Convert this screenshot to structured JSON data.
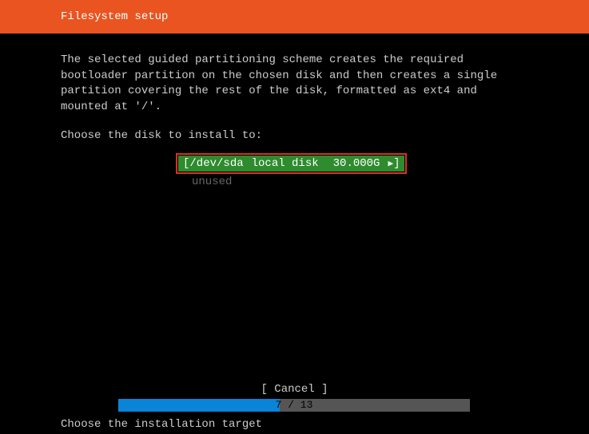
{
  "header": {
    "title": "Filesystem setup"
  },
  "main": {
    "description": "The selected guided partitioning scheme creates the required bootloader partition on the chosen disk and then creates a single partition covering the rest of the disk, formatted as ext4 and mounted at '/'.",
    "prompt": "Choose the disk to install to:",
    "disk": {
      "bracket_open": "[ ",
      "device": "/dev/sda",
      "type": "local disk",
      "size": "30.000G",
      "bracket_close": " ]"
    },
    "unused_label": "unused"
  },
  "cancel": {
    "label": "[ Cancel    ]"
  },
  "progress": {
    "label": "7 / 13"
  },
  "footer": {
    "hint": "Choose the installation target"
  }
}
